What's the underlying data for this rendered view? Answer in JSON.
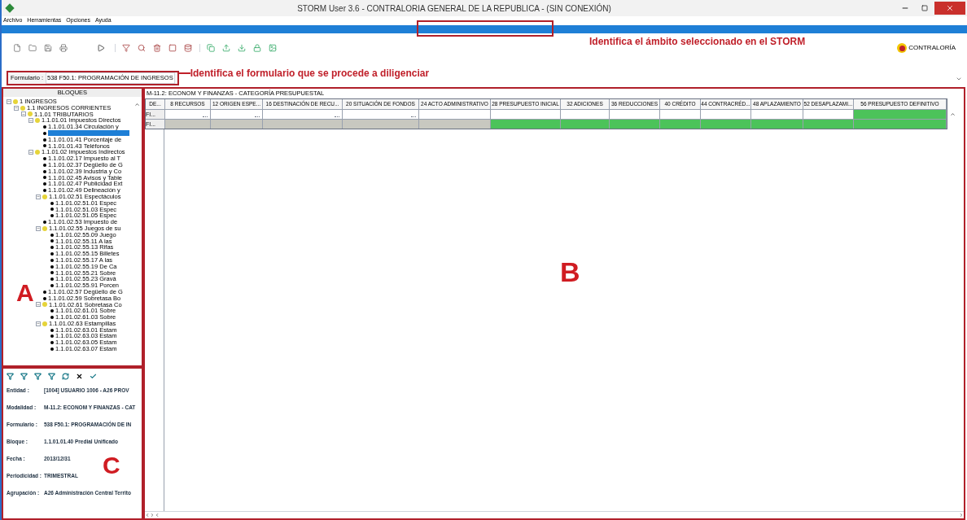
{
  "window": {
    "title": "STORM User 3.6 - CONTRALORIA GENERAL DE LA REPUBLICA -  (SIN CONEXIÓN)"
  },
  "menu": [
    "Archivo",
    "Herramientas",
    "Opciones",
    "Ayuda"
  ],
  "logo": {
    "text": "CONTRALORÍA"
  },
  "formulario": {
    "label": "Formulario :",
    "value": "538 F50.1: PROGRAMACIÓN DE INGRESOS"
  },
  "annotations": [
    {
      "kind": "formulario",
      "text": "Identifica el formulario que se procede a diligenciar"
    },
    {
      "kind": "ambito",
      "text": "Identifica el ámbito seleccionado en el STORM"
    }
  ],
  "region_labels": [
    "A",
    "B",
    "C"
  ],
  "tree": {
    "title": "BLOQUES",
    "items": [
      {
        "label": "1 INGRESOS",
        "expanded": true,
        "selected": false,
        "children": [
          {
            "label": "1.1 INGRESOS CORRIENTES",
            "expanded": true,
            "selected": false,
            "children": [
              {
                "label": "1.1.01 TRIBUTARIOS",
                "expanded": true,
                "selected": false,
                "children": [
                  {
                    "label": "1.1.01.01 Impuestos Directos",
                    "expanded": true,
                    "selected": false,
                    "children": [
                      {
                        "label": "1.1.01.01.34 Circulación y",
                        "selected": false
                      },
                      {
                        "selected": true
                      },
                      {
                        "label": "1.1.01.01.41 Porcentaje de",
                        "selected": false
                      },
                      {
                        "label": "1.1.01.01.43 Teléfonos",
                        "selected": false
                      }
                    ]
                  },
                  {
                    "label": "1.1.01.02 Impuestos Indirectos",
                    "expanded": true,
                    "selected": false,
                    "children": [
                      {
                        "label": "1.1.01.02.17 Impuesto al T",
                        "selected": false
                      },
                      {
                        "label": "1.1.01.02.37 Degüello de G",
                        "selected": false
                      },
                      {
                        "label": "1.1.01.02.39 Industria y Co",
                        "selected": false
                      },
                      {
                        "label": "1.1.01.02.45 Avisos y Table",
                        "selected": false
                      },
                      {
                        "label": "1.1.01.02.47 Publicidad Ext",
                        "selected": false
                      },
                      {
                        "label": "1.1.01.02.49 Delineación y",
                        "selected": false
                      },
                      {
                        "label": "1.1.01.02.51 Espectáculos",
                        "expanded": true,
                        "selected": false,
                        "children": [
                          {
                            "label": "1.1.01.02.51.01 Espec",
                            "selected": false
                          },
                          {
                            "label": "1.1.01.02.51.03 Espec",
                            "selected": false
                          },
                          {
                            "label": "1.1.01.02.51.05 Espec",
                            "selected": false
                          }
                        ]
                      },
                      {
                        "label": "1.1.01.02.53 Impuesto de",
                        "selected": false
                      },
                      {
                        "label": "1.1.01.02.55 Juegos de su",
                        "expanded": true,
                        "selected": false,
                        "children": [
                          {
                            "label": "1.1.01.02.55.09 Juego",
                            "selected": false
                          },
                          {
                            "label": "1.1.01.02.55.11 A las",
                            "selected": false
                          },
                          {
                            "label": "1.1.01.02.55.13 Rifas",
                            "selected": false
                          },
                          {
                            "label": "1.1.01.02.55.15 Billetes",
                            "selected": false
                          },
                          {
                            "label": "1.1.01.02.55.17 A las",
                            "selected": false
                          },
                          {
                            "label": "1.1.01.02.55.19 De Ca",
                            "selected": false
                          },
                          {
                            "label": "1.1.01.02.55.21 Sobre",
                            "selected": false
                          },
                          {
                            "label": "1.1.01.02.55.23 Gravá",
                            "selected": false
                          },
                          {
                            "label": "1.1.01.02.55.91 Porcen",
                            "selected": false
                          }
                        ]
                      },
                      {
                        "label": "1.1.01.02.57 Degüello de G",
                        "selected": false
                      },
                      {
                        "label": "1.1.01.02.59 Sobretasa Bo",
                        "selected": false
                      },
                      {
                        "label": "1.1.01.02.61 Sobretasa Co",
                        "expanded": true,
                        "selected": false,
                        "children": [
                          {
                            "label": "1.1.01.02.61.01 Sobre",
                            "selected": false
                          },
                          {
                            "label": "1.1.01.02.61.03 Sobre",
                            "selected": false
                          }
                        ]
                      },
                      {
                        "label": "1.1.01.02.63 Estampillas",
                        "expanded": true,
                        "selected": false,
                        "children": [
                          {
                            "label": "1.1.01.02.63.01 Estam",
                            "selected": false
                          },
                          {
                            "label": "1.1.01.02.63.03 Estam",
                            "selected": false
                          },
                          {
                            "label": "1.1.01.02.63.05 Estam",
                            "selected": false
                          },
                          {
                            "label": "1.1.01.02.63.07 Estam",
                            "selected": false
                          }
                        ]
                      }
                    ]
                  }
                ]
              }
            ]
          }
        ]
      }
    ]
  },
  "info": [
    {
      "label": "Entidad :",
      "value": "[1004] USUARIO 1006 - A26 PROV"
    },
    {
      "label": "Modalidad :",
      "value": "M-11.2: ECONOM Y FINANZAS - CAT"
    },
    {
      "label": "Formulario :",
      "value": "538 F50.1: PROGRAMACIÓN DE IN"
    },
    {
      "label": "Bloque :",
      "value": "1.1.01.01.40 Predial Unificado"
    },
    {
      "label": "Fecha :",
      "value": "2013/12/31"
    },
    {
      "label": "Periodicidad :",
      "value": "TRIMESTRAL"
    },
    {
      "label": "Agrupación :",
      "value": "A26 Administración Central Territo"
    }
  ],
  "grid": {
    "subtitle": "M-11.2: ECONOM Y FINANZAS - CATEGORÍA PRESUPUESTAL",
    "columns": [
      "DE...",
      "8 RECURSOS",
      "12 ORIGEN ESPE...",
      "16 DESTINACIÓN DE RECU...",
      "20 SITUACIÓN DE FONDOS",
      "24 ACTO ADMINISTRATIVO",
      "28 PRESUPUESTO INICIAL",
      "32 ADICIONES",
      "36 REDUCCIONES",
      "40 CRÉDITO",
      "44 CONTRACRÉD...",
      "48 APLAZAMIENTO",
      "52 DESAPLAZAMI...",
      "56 PRESUPUESTO DEFINITIVO"
    ],
    "rows": [
      {
        "header": "FI...",
        "cells": [
          {
            "kind": "lookup"
          },
          {
            "kind": "lookup"
          },
          {
            "kind": "lookup"
          },
          {
            "kind": "lookup"
          },
          {
            "kind": "input"
          },
          {
            "kind": "input"
          },
          {
            "kind": "input"
          },
          {
            "kind": "input"
          },
          {
            "kind": "input"
          },
          {
            "kind": "input"
          },
          {
            "kind": "input"
          },
          {
            "kind": "input"
          },
          {
            "kind": "computed"
          }
        ]
      },
      {
        "header": "FI...",
        "cells": [
          {
            "kind": "readonly"
          },
          {
            "kind": "readonly"
          },
          {
            "kind": "readonly"
          },
          {
            "kind": "readonly"
          },
          {
            "kind": "readonly"
          },
          {
            "kind": "computed"
          },
          {
            "kind": "computed"
          },
          {
            "kind": "computed"
          },
          {
            "kind": "computed"
          },
          {
            "kind": "computed"
          },
          {
            "kind": "computed"
          },
          {
            "kind": "computed"
          },
          {
            "kind": "computed"
          }
        ]
      }
    ]
  }
}
